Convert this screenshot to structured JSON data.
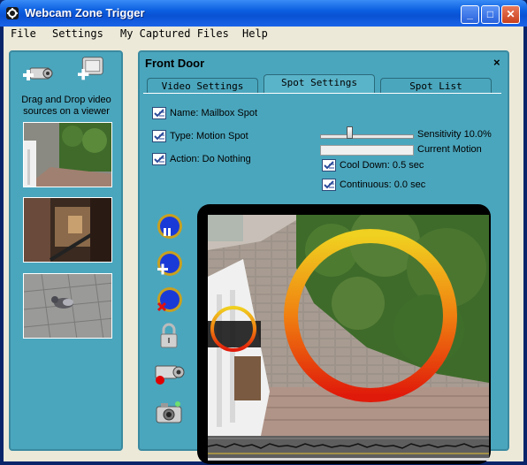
{
  "window": {
    "title": "Webcam Zone Trigger",
    "buttons": {
      "minimize": "_",
      "maximize": "□",
      "close": "✕"
    }
  },
  "menu": {
    "items": [
      "File",
      "Settings",
      "My Captured Files",
      "Help"
    ]
  },
  "sidebar": {
    "drag_text": "Drag and Drop video sources on a viewer",
    "icons": [
      "add-camera-icon",
      "add-capture-device-icon"
    ],
    "thumbnails": [
      "front-porch-thumbnail",
      "stairway-thumbnail",
      "pigeon-thumbnail"
    ]
  },
  "viewer": {
    "title": "Front Door",
    "close_label": "×",
    "tabs": [
      {
        "label": "Video Settings",
        "active": false
      },
      {
        "label": "Spot Settings",
        "active": true
      },
      {
        "label": "Spot List",
        "active": false
      }
    ],
    "spot_settings": {
      "name": "Name: Mailbox Spot",
      "type": "Type: Motion Spot",
      "action": "Action: Do Nothing",
      "sensitivity_label": "Sensitivity 10.0%",
      "sensitivity_value": 0.1,
      "current_motion_label": "Current Motion",
      "cool_down": "Cool Down: 0.5 sec",
      "continuous": "Continuous: 0.0 sec"
    },
    "tools": [
      "pause-spot-icon",
      "add-spot-icon",
      "delete-spot-icon",
      "lock-icon",
      "record-camera-icon",
      "snapshot-camera-icon"
    ]
  },
  "colors": {
    "panel": "#4aa6bd",
    "titlebar": "#0a52d4",
    "spot_ring_outer": "#e8c020",
    "spot_ring_inner": "#e03010"
  }
}
